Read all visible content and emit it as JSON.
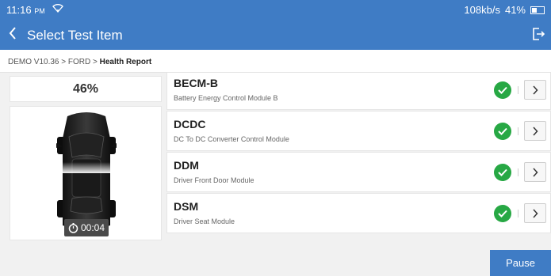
{
  "status_bar": {
    "time": "11:16",
    "ampm": "PM",
    "network_speed": "108kb/s",
    "battery": "41%",
    "battery_level": 0.41,
    "wifi_icon": "wifi-icon"
  },
  "header": {
    "title": "Select Test Item",
    "back_icon": "chevron-left-icon",
    "exit_icon": "exit-icon"
  },
  "breadcrumb": {
    "path": "DEMO V10.36 > FORD > ",
    "current": "Health Report"
  },
  "progress": {
    "percent_label": "46%",
    "value": 0.46
  },
  "timer": {
    "icon": "stopwatch-icon",
    "value": "00:04"
  },
  "modules": [
    {
      "name": "BECM-B",
      "description": "Battery Energy Control Module B",
      "status": "ok"
    },
    {
      "name": "DCDC",
      "description": "DC To DC Converter Control Module",
      "status": "ok"
    },
    {
      "name": "DDM",
      "description": "Driver Front Door Module",
      "status": "ok"
    },
    {
      "name": "DSM",
      "description": "Driver Seat Module",
      "status": "ok"
    }
  ],
  "actions": {
    "pause_label": "Pause"
  },
  "colors": {
    "primary": "#3f7cc5",
    "success": "#27a844",
    "background": "#f1f1f1"
  }
}
